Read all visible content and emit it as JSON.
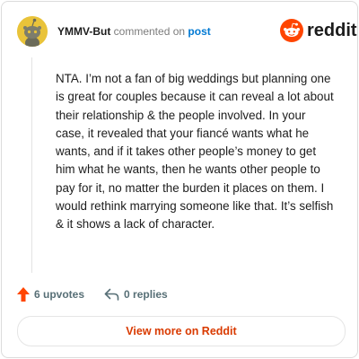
{
  "comment": {
    "author": "YMMV-But",
    "action_text": "commented on",
    "post_link": "post",
    "body": "NTA. I’m not a fan of big weddings but planning one is great for couples because it can reveal a lot about their relationship & the people involved. In your case, it revealed that your fiancé wants what he wants, and if it takes other people’s money to get him what he wants, then he wants other people to pay for it, no matter the burden it places on them. I would rethink marrying someone like that. It’s selfish & it shows a lack of character.",
    "avatar_icon": "snoo-avatar-icon"
  },
  "brand": {
    "name": "reddit",
    "icon": "reddit-logo-icon",
    "color": "#ff4500"
  },
  "actions": {
    "upvotes": "6 upvotes",
    "upvote_icon": "upvote-arrow-icon",
    "upvote_color": "#ff4500",
    "replies": "0 replies",
    "reply_icon": "reply-arrow-icon"
  },
  "footer": {
    "view_more_label": "View more on Reddit",
    "accent_color": "#d93a00"
  }
}
